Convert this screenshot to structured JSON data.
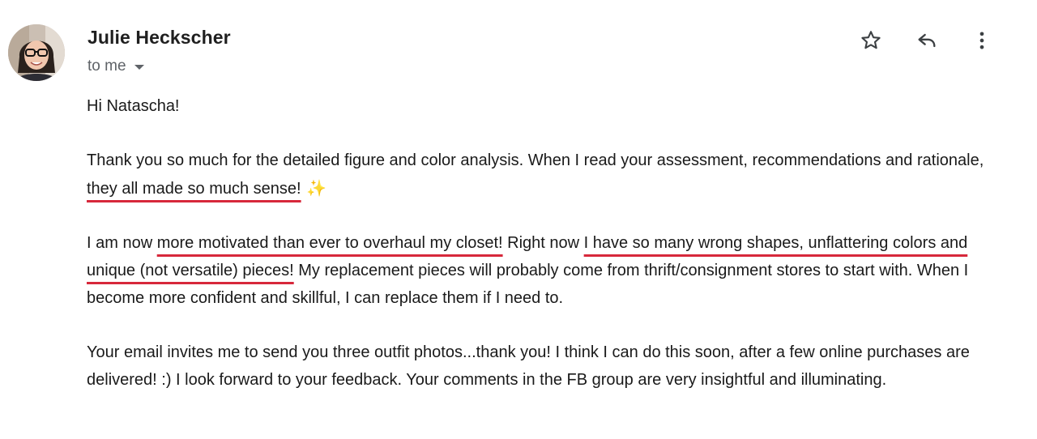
{
  "sender": {
    "name": "Julie Heckscher",
    "recipient": "to me"
  },
  "actions": {
    "star_icon": "star-icon",
    "reply_icon": "reply-icon",
    "more_icon": "more-vert-icon"
  },
  "body": {
    "greeting": "Hi Natascha!",
    "p1_a": "Thank you so much for the detailed figure and color analysis. When I read your assessment, recommendations and rationale, ",
    "p1_b": "they all made so much sense!",
    "p1_sparkle": " ✨",
    "p2_a": "I am now ",
    "p2_b": "more motivated than ever to overhaul my closet!",
    "p2_c": " Right now ",
    "p2_d": "I have so many wrong shapes, unflattering colors and unique (not versatile) pieces!",
    "p2_e": " My replacement pieces will probably come from thrift/consignment stores to start with. When I become more confident and skillful, I can replace them if I need to.",
    "p3": "Your email invites me to send you three outfit photos...thank you! I think I can do this soon, after a few online purchases are delivered! :)  I look forward to your feedback. Your comments in the FB group are very insightful and illuminating."
  },
  "colors": {
    "highlight_underline": "#d7283b",
    "icon": "#3c4043",
    "secondary_text": "#5f6368"
  }
}
